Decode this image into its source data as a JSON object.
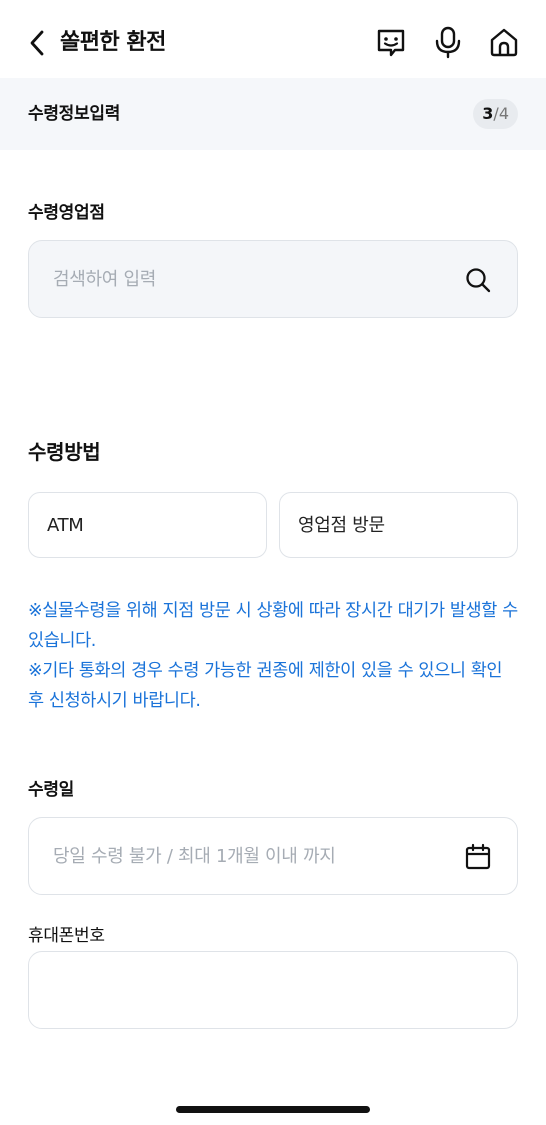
{
  "header": {
    "title": "쏠편한 환전",
    "icons": [
      "chevron-left-icon",
      "chat-bot-icon",
      "microphone-icon",
      "home-icon"
    ]
  },
  "step": {
    "title": "수령정보입력",
    "current": "3",
    "separator": "/",
    "total": "4"
  },
  "branch": {
    "label": "수령영업점",
    "placeholder": "검색하여 입력",
    "icon": "search-icon"
  },
  "method": {
    "label": "수령방법",
    "options": [
      "ATM",
      "영업점 방문"
    ]
  },
  "notices": [
    "※실물수령을 위해 지점 방문 시 상황에 따라 장시간 대기가 발생할 수 있습니다.",
    "※기타 통화의 경우 수령 가능한 권종에 제한이 있을 수 있으니 확인 후 신청하시기 바랍니다."
  ],
  "date": {
    "label": "수령일",
    "placeholder": "당일 수령 불가 / 최대 1개월 이내 까지",
    "icon": "calendar-icon"
  },
  "phone": {
    "label": "휴대폰번호",
    "value": ""
  },
  "colors": {
    "notice": "#1a73d9",
    "step_bg": "#f5f7fa",
    "field_bg": "#f4f6f9",
    "border": "#dfe3e8"
  }
}
